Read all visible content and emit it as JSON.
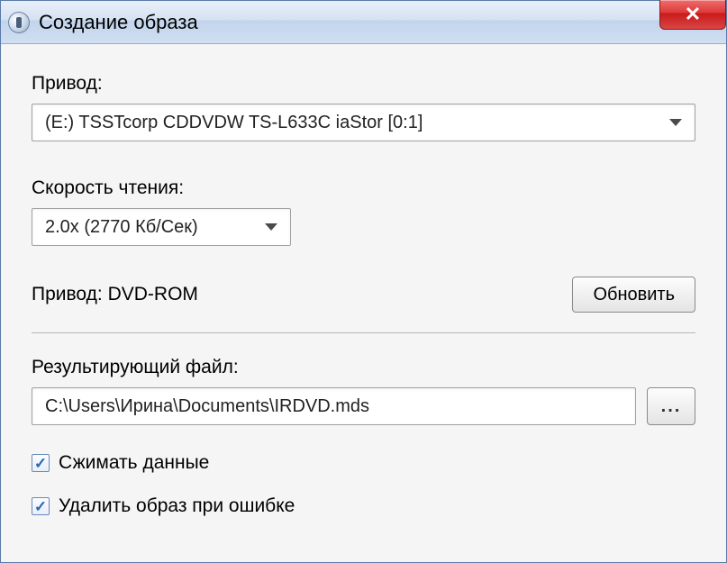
{
  "window": {
    "title": "Создание образа"
  },
  "drive_section": {
    "label": "Привод:",
    "selected": "(E:) TSSTcorp CDDVDW TS-L633C iaStor [0:1]"
  },
  "speed_section": {
    "label": "Скорость чтения:",
    "selected": "2.0x (2770 Кб/Сек)"
  },
  "drive_info": {
    "label": "Привод:",
    "value": "DVD-ROM",
    "refresh_button": "Обновить"
  },
  "result_file": {
    "label": "Результирующий файл:",
    "path": "C:\\Users\\Ирина\\Documents\\IRDVD.mds",
    "browse_label": "..."
  },
  "checkboxes": {
    "compress": "Сжимать данные",
    "delete_on_error": "Удалить образ при ошибке"
  }
}
